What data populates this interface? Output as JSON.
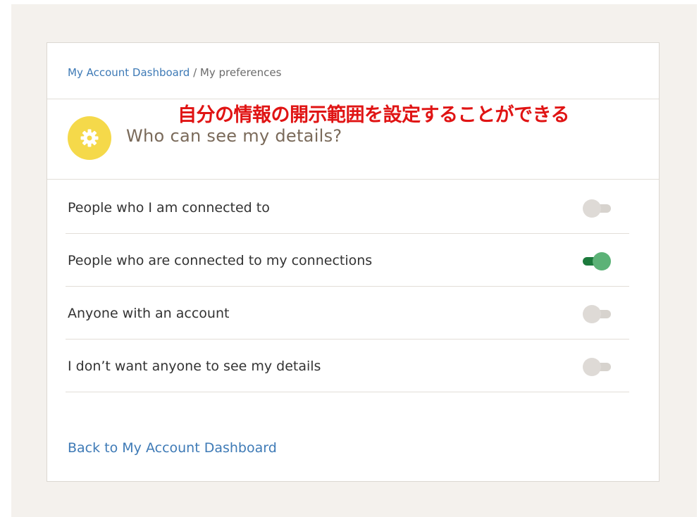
{
  "breadcrumb": {
    "parent": "My Account Dashboard",
    "separator": " / ",
    "current": "My preferences"
  },
  "annotation": "自分の情報の開示範囲を設定することができる",
  "section": {
    "icon": "gear-icon",
    "title": "Who can see my details?"
  },
  "options": [
    {
      "label": "People who I am connected to",
      "enabled": false
    },
    {
      "label": "People who are connected to my connections",
      "enabled": true
    },
    {
      "label": "Anyone with an account",
      "enabled": false
    },
    {
      "label": "I don’t want anyone to see my details",
      "enabled": false
    }
  ],
  "back_link": "Back to My Account Dashboard",
  "colors": {
    "background": "#f4f1ed",
    "link": "#3e7ab6",
    "accent_icon": "#f5d94a",
    "annotation": "#e01414",
    "toggle_on": "#1c7a3c",
    "toggle_off": "#d7d3ce"
  }
}
